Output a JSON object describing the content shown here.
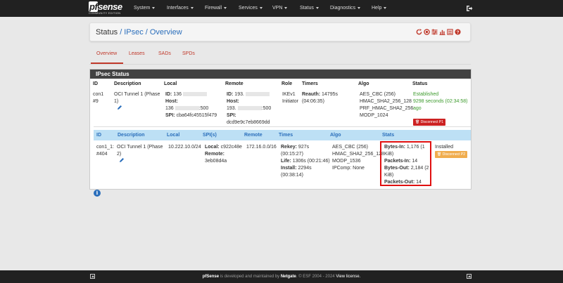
{
  "brand": {
    "name_pf": "pf",
    "name_rest": "sense",
    "edition": "COMMUNITY EDITION"
  },
  "nav": [
    "System",
    "Interfaces",
    "Firewall",
    "Services",
    "VPN",
    "Status",
    "Diagnostics",
    "Help"
  ],
  "breadcrumb": {
    "first": "Status",
    "second": "IPsec",
    "third": "Overview"
  },
  "tabs": [
    "Overview",
    "Leases",
    "SADs",
    "SPDs"
  ],
  "panel_title": "IPsec Status",
  "p1_headers": [
    "ID",
    "Description",
    "Local",
    "Remote",
    "Role",
    "Timers",
    "Algo",
    "Status"
  ],
  "p1": {
    "id_a": "con1",
    "id_b": "#9",
    "desc_a": "OCI Tunnel 1 (Phase",
    "desc_b": "1)",
    "local_id_label": "ID:",
    "local_id": "136",
    "local_host_label": "Host:",
    "local_host": "136",
    "local_port": ":500",
    "local_spi_label": "SPI:",
    "local_spi": "cba64fc45515f479",
    "remote_id_label": "ID:",
    "remote_id": "193.",
    "remote_host_label": "Host:",
    "remote_host": "193.",
    "remote_port": ":500",
    "remote_spi_label": "SPI:",
    "remote_spi": "dcd9e9c7eb8669dd",
    "role_a": "IKEv1",
    "role_b": "Initiator",
    "timer_label": "Reauth:",
    "timer_a": "14795s",
    "timer_b": "(04:06:35)",
    "algo": [
      "AES_CBC (256)",
      "HMAC_SHA2_256_128",
      "PRF_HMAC_SHA2_256",
      "MODP_1024"
    ],
    "status_a": "Established",
    "status_b": "9298 seconds (02:34:58)",
    "status_c": "ago",
    "disconnect": "Disconnect P1"
  },
  "p2_headers": [
    "ID",
    "Description",
    "Local",
    "SPI(s)",
    "Remote",
    "Times",
    "Algo",
    "Stats"
  ],
  "p2": {
    "id_a": "con1_1:",
    "id_b": "#404",
    "desc_a": "OCI Tunnel 1 (Phase",
    "desc_b": "2)",
    "local": "10.222.10.0/24",
    "spi_local_label": "Local:",
    "spi_local": "c922c48e",
    "spi_remote_label": "Remote:",
    "spi_remote": "3eb08d4a",
    "remote": "172.16.0.0/16",
    "rekey_label": "Rekey:",
    "rekey_a": "927s",
    "rekey_b": "(00:15:27)",
    "life_label": "Life:",
    "life_a": "1306s (00:21:46)",
    "install_label": "Install:",
    "install_a": "2294s",
    "install_b": "(00:38:14)",
    "algo": [
      "AES_CBC (256)",
      "HMAC_SHA2_256_128",
      "MODP_1536",
      "IPComp: None"
    ],
    "bytes_in_label": "Bytes-In:",
    "bytes_in_a": "1,176 (1",
    "bytes_in_b": "KiB)",
    "packets_in_label": "Packets-In:",
    "packets_in": "14",
    "bytes_out_label": "Bytes-Out:",
    "bytes_out_a": "2,184 (2",
    "bytes_out_b": "KiB)",
    "packets_out_label": "Packets-Out:",
    "packets_out": "14",
    "state": "Installed",
    "disconnect": "Disconnect P2"
  },
  "footer": {
    "brand": "pfSense",
    "mid": " is developed and maintained by ",
    "company": "Netgate",
    "copy": ". © ESF 2004 - 2024 ",
    "license": "View license."
  },
  "colors": {
    "navbar": "#212121",
    "accent_red": "#c0392b",
    "link_blue": "#2a6ebb",
    "status_green": "#3c9a2c",
    "p2_header_bg": "#bde0f5"
  }
}
